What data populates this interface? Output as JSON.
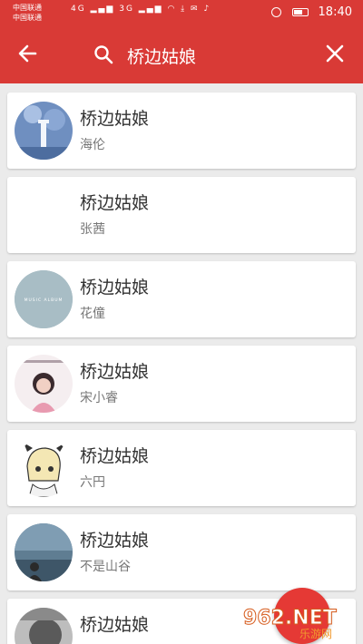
{
  "status_bar": {
    "carrier_1": "中国联通",
    "carrier_2": "中国联通",
    "network_1": "4G",
    "network_2": "3G",
    "time": "18:40"
  },
  "toolbar": {
    "search_query": "桥边姑娘"
  },
  "results": [
    {
      "title": "桥边姑娘",
      "artist": "海伦"
    },
    {
      "title": "桥边姑娘",
      "artist": "张茜"
    },
    {
      "title": "桥边姑娘",
      "artist": "花僮",
      "cover_text": "MUSIC ALBUM"
    },
    {
      "title": "桥边姑娘",
      "artist": "宋小睿"
    },
    {
      "title": "桥边姑娘",
      "artist": "六円"
    },
    {
      "title": "桥边姑娘",
      "artist": "不是山谷"
    },
    {
      "title": "桥边姑娘",
      "artist": ""
    }
  ],
  "watermark": {
    "brand": "962.NET",
    "subtitle": "乐游网"
  },
  "colors": {
    "primary": "#d93a36",
    "background": "#ebebeb",
    "card": "#ffffff"
  }
}
